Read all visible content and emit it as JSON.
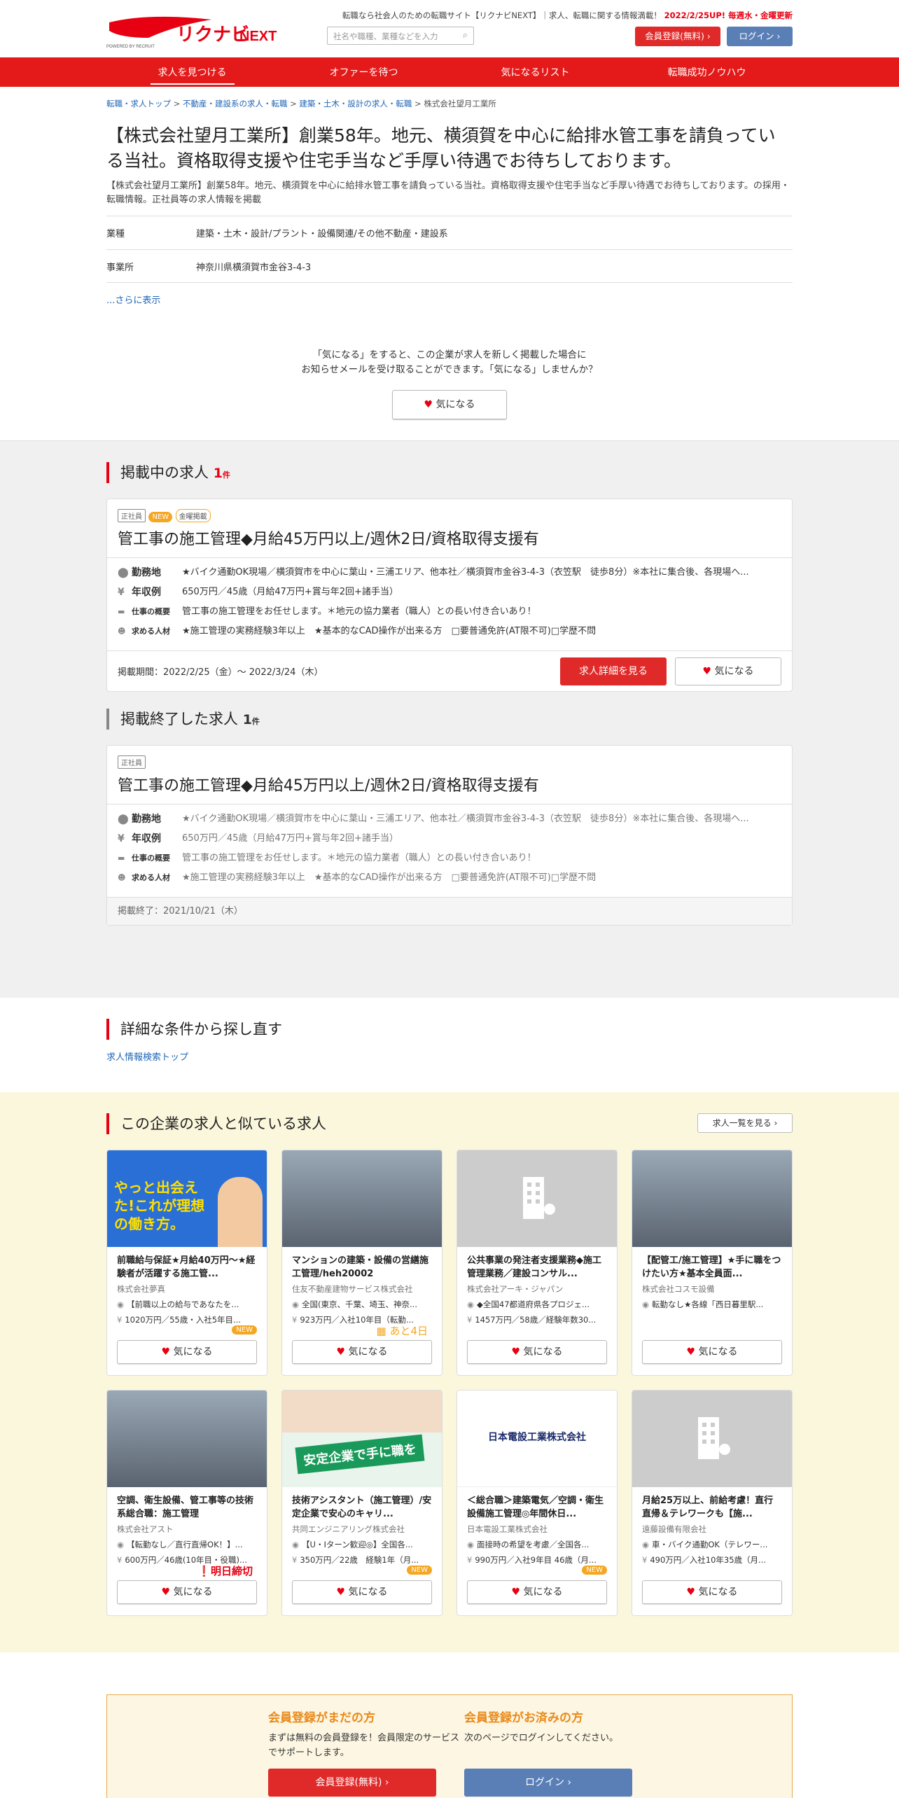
{
  "header": {
    "logo_text": "リクナビNEXT",
    "logo_sub": "POWERED BY RECRUIT",
    "tagline": "転職なら社会人のための転職サイト【リクナビNEXT】｜求人、転職に関する情報満載！",
    "tagline_highlight": "2022/2/25UP! 毎週水・金曜更新",
    "search_placeholder": "社名や職種、業種などを入力",
    "register": "会員登録(無料)",
    "login": "ログイン"
  },
  "nav": [
    "求人を見つける",
    "オファーを待つ",
    "気になるリスト",
    "転職成功ノウハウ"
  ],
  "breadcrumb": [
    "転職・求人トップ",
    "不動産・建設系の求人・転職",
    "建築・土木・設計の求人・転職",
    "株式会社望月工業所"
  ],
  "company": {
    "title": "【株式会社望月工業所】創業58年。地元、横須賀を中心に給排水管工事を請負っている当社。資格取得支援や住宅手当など手厚い待遇でお待ちしております。",
    "lead": "【株式会社望月工業所】創業58年。地元、横須賀を中心に給排水管工事を請負っている当社。資格取得支援や住宅手当など手厚い待遇でお待ちしております。の採用・転職情報。正社員等の求人情報を掲載",
    "industry_label": "業種",
    "industry": "建築・土木・設計/プラント・設備関連/その他不動産・建設系",
    "office_label": "事業所",
    "office": "神奈川県横須賀市金谷3-4-3",
    "more": "...さらに表示"
  },
  "kininaru": {
    "line1": "「気になる」をすると、この企業が求人を新しく掲載した場合に",
    "line2": "お知らせメールを受け取ることができます。「気になる」しませんか？",
    "button": "気になる"
  },
  "active": {
    "heading": "掲載中の求人",
    "count": "1",
    "unit": "件",
    "tags": [
      "正社員",
      "NEW",
      "金曜掲載"
    ],
    "title": "管工事の施工管理◆月給45万円以上/週休2日/資格取得支援有",
    "loc_label": "勤務地",
    "loc": "★バイク通勤OK現場／横須賀市を中心に葉山・三浦エリア、他本社／横須賀市金谷3-4-3（衣笠駅　徒歩8分）※本社に集合後、各現場へ...",
    "pay_label": "年収例",
    "pay": "650万円／45歳（月給47万円+賞与年2回+諸手当）",
    "job_label": "仕事の概要",
    "job": "管工事の施工管理をお任せします。＊地元の協力業者（職人）との長い付き合いあり！",
    "req_label": "求める人材",
    "req": "★施工管理の実務経験3年以上　★基本的なCAD操作が出来る方　□要普通免許(AT限不可)□学歴不問",
    "period": "掲載期間：2022/2/25（金）～ 2022/3/24（木）",
    "detail_btn": "求人詳細を見る",
    "fav_btn": "気になる"
  },
  "ended": {
    "heading": "掲載終了した求人",
    "count": "1",
    "unit": "件",
    "tag": "正社員",
    "title": "管工事の施工管理◆月給45万円以上/週休2日/資格取得支援有",
    "loc_label": "勤務地",
    "loc": "★バイク通勤OK現場／横須賀市を中心に葉山・三浦エリア、他本社／横須賀市金谷3-4-3（衣笠駅　徒歩8分）※本社に集合後、各現場へ...",
    "pay_label": "年収例",
    "pay": "650万円／45歳（月給47万円+賞与年2回+諸手当）",
    "job_label": "仕事の概要",
    "job": "管工事の施工管理をお任せします。＊地元の協力業者（職人）との長い付き合いあり！",
    "req_label": "求める人材",
    "req": "★施工管理の実務経験3年以上　★基本的なCAD操作が出来る方　□要普通免許(AT限不可)□学歴不問",
    "end": "掲載終了：2021/10/21（木）"
  },
  "detail": {
    "heading": "詳細な条件から探し直す",
    "link": "求人情報検索トップ"
  },
  "similar": {
    "heading": "この企業の求人と似ている求人",
    "list_btn": "求人一覧を見る",
    "fav": "気になる",
    "cards": [
      {
        "title": "前職給与保証★月給40万円～★経験者が活躍する施工管...",
        "company": "株式会社夢真",
        "loc": "【前職以上の給与であなたを...",
        "pay": "1020万円／55歳・入社5年目...",
        "badge": "NEW",
        "img": "ad",
        "img_text": "やっと出会えた!これが理想の働き方。"
      },
      {
        "title": "マンションの建築・設備の営繕施工管理/heh20002",
        "company": "住友不動産建物サービス株式会社",
        "loc": "全国(東京、千葉、埼玉、神奈...",
        "pay": "923万円／入社10年目（転勤...",
        "badge": "あと4日",
        "img": "photo"
      },
      {
        "title": "公共事業の発注者支援業務◆施工管理業務／建設コンサル...",
        "company": "株式会社アーキ・ジャパン",
        "loc": "◆全国47都道府県各プロジェ...",
        "pay": "1457万円／58歳／経験年数30...",
        "badge": "",
        "img": "blank"
      },
      {
        "title": "【配管工/施工管理】★手に職をつけたい方★基本全員面...",
        "company": "株式会社コスモ設備",
        "loc": "転勤なし★各線「西日暮里駅...",
        "pay": "",
        "badge": "",
        "img": "photo"
      },
      {
        "title": "空調、衛生設備、管工事等の技術系総合職：施工管理",
        "company": "株式会社アスト",
        "loc": "【転勤なし／直行直帰OK！】...",
        "pay": "600万円／46歳(10年目・役職)...",
        "badge": "明日締切",
        "img": "photo"
      },
      {
        "title": "技術アシスタント（施工管理）/安定企業で安心のキャリ...",
        "company": "共同エンジニアリング株式会社",
        "loc": "【U・Iターン歓迎◎】全国各...",
        "pay": "350万円／22歳　経験1年（月...",
        "badge": "NEW",
        "img": "ad2",
        "img_text": "安定企業で手に職を"
      },
      {
        "title": "＜総合職＞建築電気／空調・衛生設備施工管理◎年間休日...",
        "company": "日本電設工業株式会社",
        "loc": "面接時の希望を考慮／全国各...",
        "pay": "990万円／入社9年目 46歳（月...",
        "badge": "NEW",
        "img": "logo",
        "img_text": "日本電設工業株式会社"
      },
      {
        "title": "月給25万以上、前給考慮！直行直帰＆テレワークも【施...",
        "company": "遠藤設備有限会社",
        "loc": "車・バイク通勤OK（テレワー...",
        "pay": "490万円／入社10年35歳（月...",
        "badge": "",
        "img": "blank"
      }
    ]
  },
  "bottom": {
    "left_title": "会員登録がまだの方",
    "left_text": "まずは無料の会員登録を！会員限定のサービスでサポートします。",
    "left_btn": "会員登録(無料)",
    "right_title": "会員登録がお済みの方",
    "right_text": "次のページでログインしてください。",
    "right_btn": "ログイン"
  }
}
